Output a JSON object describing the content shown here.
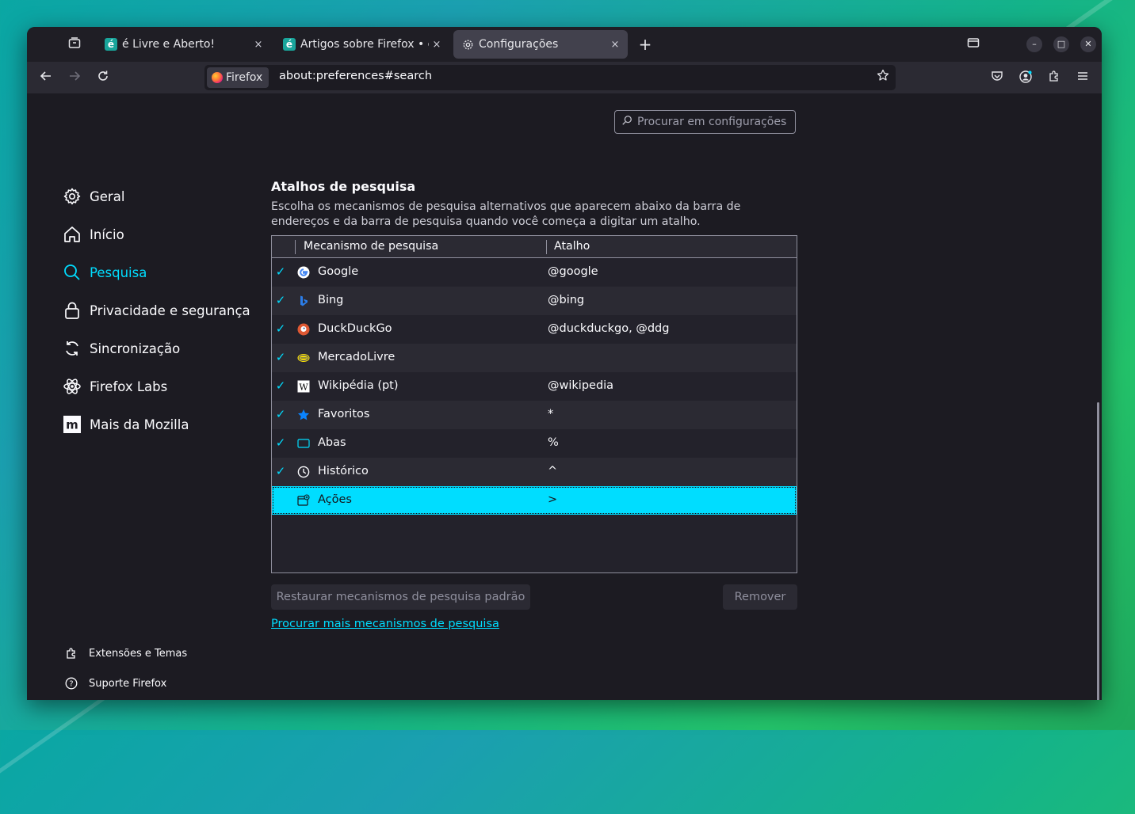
{
  "tabs": [
    {
      "title": "é Livre e Aberto!",
      "favicon": "el-logo-icon",
      "active": false
    },
    {
      "title": "Artigos sobre Firefox • é L",
      "favicon": "el-logo-icon",
      "active": false
    },
    {
      "title": "Configurações",
      "favicon": "gear-icon",
      "active": true
    }
  ],
  "tab_close_glyph": "×",
  "new_tab_glyph": "+",
  "urlbar": {
    "identity_label": "Firefox",
    "url": "about:preferences#search"
  },
  "search": {
    "placeholder": "Procurar em configurações"
  },
  "categories": [
    {
      "label": "Geral",
      "icon": "gear-icon"
    },
    {
      "label": "Início",
      "icon": "home-icon"
    },
    {
      "label": "Pesquisa",
      "icon": "search-icon",
      "selected": true
    },
    {
      "label": "Privacidade e segurança",
      "icon": "lock-icon"
    },
    {
      "label": "Sincronização",
      "icon": "sync-icon"
    },
    {
      "label": "Firefox Labs",
      "icon": "labs-icon"
    },
    {
      "label": "Mais da Mozilla",
      "icon": "mozilla-icon"
    }
  ],
  "footer_links": [
    {
      "label": "Extensões e Temas",
      "icon": "puzzle-icon"
    },
    {
      "label": "Suporte Firefox",
      "icon": "help-icon"
    }
  ],
  "section": {
    "title": "Atalhos de pesquisa",
    "description": "Escolha os mecanismos de pesquisa alternativos que aparecem abaixo da barra de endereços e da barra de pesquisa quando você começa a digitar um atalho."
  },
  "table": {
    "col_engine": "Mecanismo de pesquisa",
    "col_keyword": "Atalho",
    "rows": [
      {
        "name": "Google",
        "keyword": "@google",
        "checked": true,
        "icon": "google-icon"
      },
      {
        "name": "Bing",
        "keyword": "@bing",
        "checked": true,
        "icon": "bing-icon"
      },
      {
        "name": "DuckDuckGo",
        "keyword": "@duckduckgo, @ddg",
        "checked": true,
        "icon": "duckduckgo-icon"
      },
      {
        "name": "MercadoLivre",
        "keyword": "",
        "checked": true,
        "icon": "mercadolivre-icon"
      },
      {
        "name": "Wikipédia (pt)",
        "keyword": "@wikipedia",
        "checked": true,
        "icon": "wikipedia-icon"
      },
      {
        "name": "Favoritos",
        "keyword": "*",
        "checked": true,
        "icon": "star-icon"
      },
      {
        "name": "Abas",
        "keyword": "%",
        "checked": true,
        "icon": "tab-icon"
      },
      {
        "name": "Histórico",
        "keyword": "^",
        "checked": true,
        "icon": "clock-icon"
      },
      {
        "name": "Ações",
        "keyword": ">",
        "checked": false,
        "icon": "actions-icon",
        "selected": true
      }
    ]
  },
  "buttons": {
    "restore": "Restaurar mecanismos de pesquisa padrão",
    "remove": "Remover"
  },
  "more_link": "Procurar mais mecanismos de pesquisa",
  "colors": {
    "accent": "#00ddff",
    "background": "#1c1b22"
  }
}
